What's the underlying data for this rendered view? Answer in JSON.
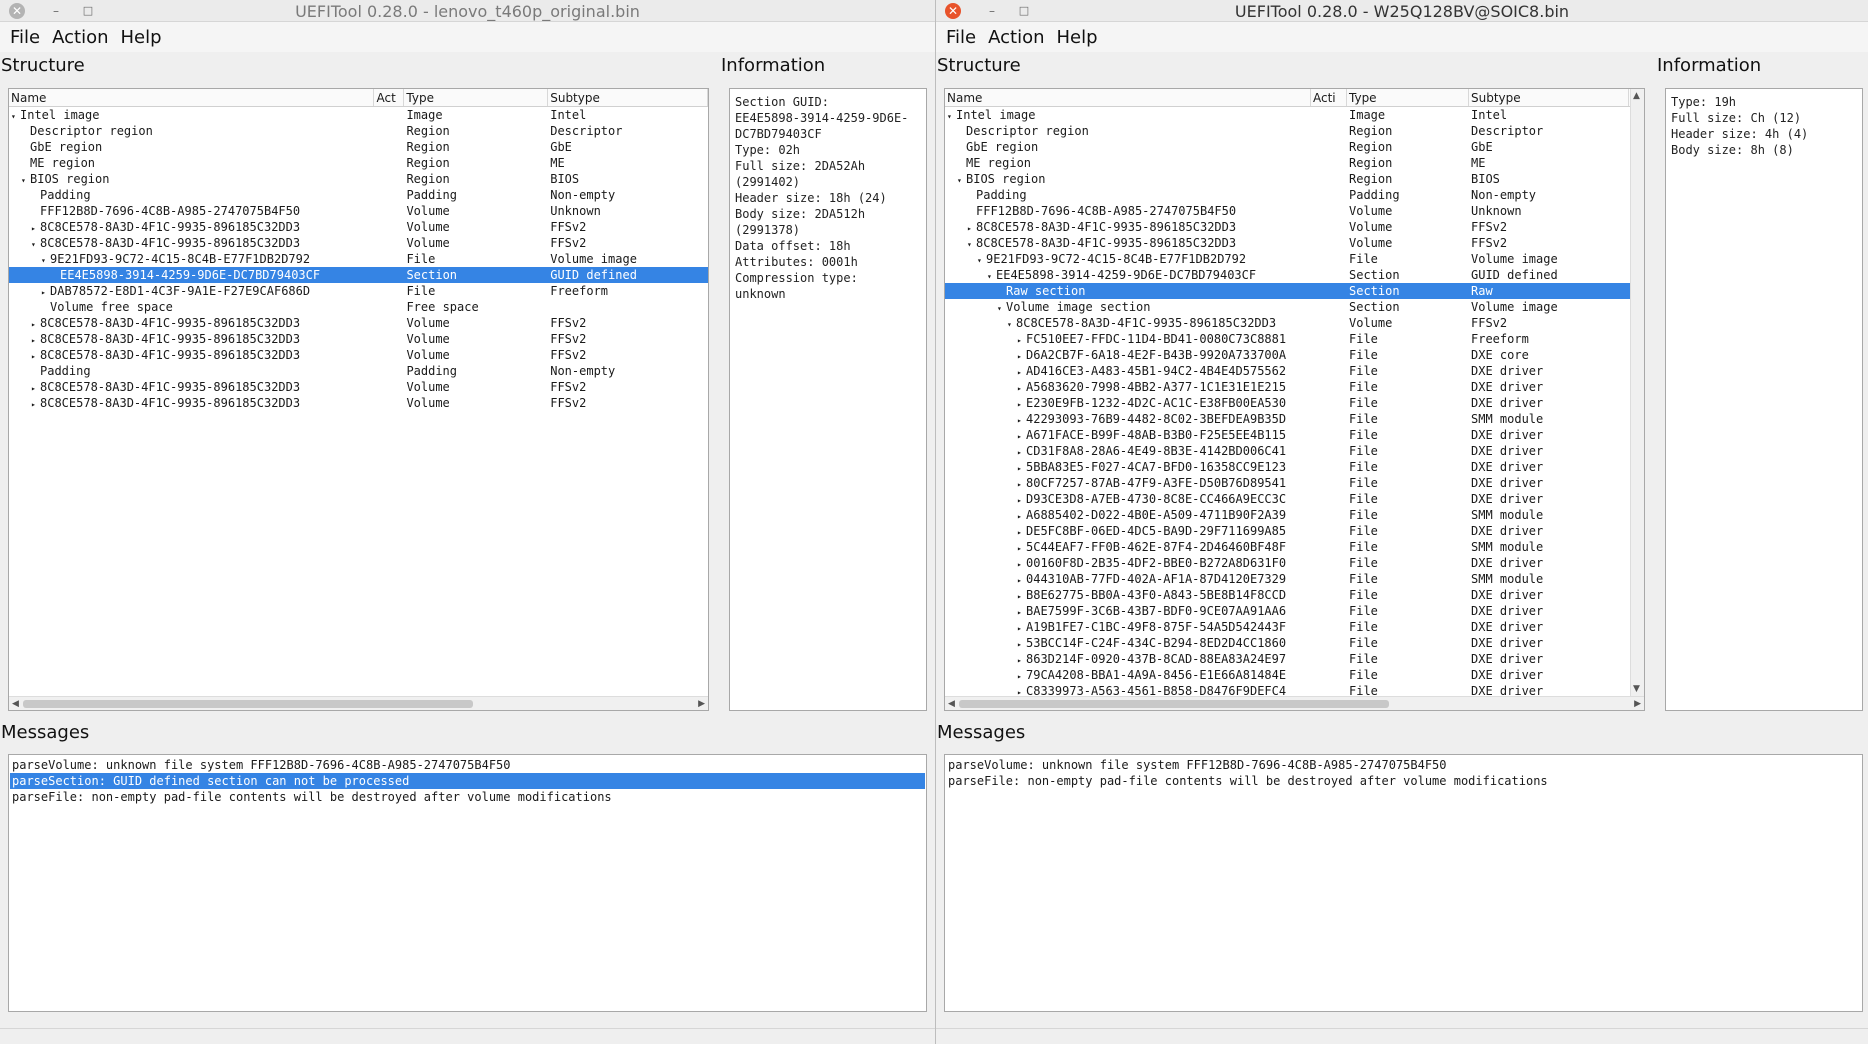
{
  "left": {
    "title": "UEFITool 0.28.0 - lenovo_t460p_original.bin",
    "menu": [
      "File",
      "Action",
      "Help"
    ],
    "structure_label": "Structure",
    "information_label": "Information",
    "messages_label": "Messages",
    "columns": [
      "Name",
      "Act",
      "Type",
      "Subtype"
    ],
    "rows": [
      {
        "indent": 0,
        "arrow": "down",
        "name": "Intel image",
        "type": "Image",
        "subtype": "Intel"
      },
      {
        "indent": 1,
        "arrow": "",
        "name": "Descriptor region",
        "type": "Region",
        "subtype": "Descriptor"
      },
      {
        "indent": 1,
        "arrow": "",
        "name": "GbE region",
        "type": "Region",
        "subtype": "GbE"
      },
      {
        "indent": 1,
        "arrow": "",
        "name": "ME region",
        "type": "Region",
        "subtype": "ME"
      },
      {
        "indent": 1,
        "arrow": "down",
        "name": "BIOS region",
        "type": "Region",
        "subtype": "BIOS"
      },
      {
        "indent": 2,
        "arrow": "",
        "name": "Padding",
        "type": "Padding",
        "subtype": "Non-empty"
      },
      {
        "indent": 2,
        "arrow": "",
        "name": "FFF12B8D-7696-4C8B-A985-2747075B4F50",
        "type": "Volume",
        "subtype": "Unknown"
      },
      {
        "indent": 2,
        "arrow": "right",
        "name": "8C8CE578-8A3D-4F1C-9935-896185C32DD3",
        "type": "Volume",
        "subtype": "FFSv2"
      },
      {
        "indent": 2,
        "arrow": "down",
        "name": "8C8CE578-8A3D-4F1C-9935-896185C32DD3",
        "type": "Volume",
        "subtype": "FFSv2"
      },
      {
        "indent": 3,
        "arrow": "down",
        "name": "9E21FD93-9C72-4C15-8C4B-E77F1DB2D792",
        "type": "File",
        "subtype": "Volume image"
      },
      {
        "indent": 4,
        "arrow": "",
        "name": "EE4E5898-3914-4259-9D6E-DC7BD79403CF",
        "type": "Section",
        "subtype": "GUID defined",
        "selected": true
      },
      {
        "indent": 3,
        "arrow": "right",
        "name": "DAB78572-E8D1-4C3F-9A1E-F27E9CAF686D",
        "type": "File",
        "subtype": "Freeform"
      },
      {
        "indent": 3,
        "arrow": "",
        "name": "Volume free space",
        "type": "Free space",
        "subtype": ""
      },
      {
        "indent": 2,
        "arrow": "right",
        "name": "8C8CE578-8A3D-4F1C-9935-896185C32DD3",
        "type": "Volume",
        "subtype": "FFSv2"
      },
      {
        "indent": 2,
        "arrow": "right",
        "name": "8C8CE578-8A3D-4F1C-9935-896185C32DD3",
        "type": "Volume",
        "subtype": "FFSv2"
      },
      {
        "indent": 2,
        "arrow": "right",
        "name": "8C8CE578-8A3D-4F1C-9935-896185C32DD3",
        "type": "Volume",
        "subtype": "FFSv2"
      },
      {
        "indent": 2,
        "arrow": "",
        "name": "Padding",
        "type": "Padding",
        "subtype": "Non-empty"
      },
      {
        "indent": 2,
        "arrow": "right",
        "name": "8C8CE578-8A3D-4F1C-9935-896185C32DD3",
        "type": "Volume",
        "subtype": "FFSv2"
      },
      {
        "indent": 2,
        "arrow": "right",
        "name": "8C8CE578-8A3D-4F1C-9935-896185C32DD3",
        "type": "Volume",
        "subtype": "FFSv2"
      }
    ],
    "info": "Section GUID:\nEE4E5898-3914-4259-9D6E-\nDC7BD79403CF\nType: 02h\nFull size: 2DA52Ah\n(2991402)\nHeader size: 18h (24)\nBody size: 2DA512h\n(2991378)\nData offset: 18h\nAttributes: 0001h\nCompression type:\nunknown",
    "messages": [
      {
        "text": "parseVolume: unknown file system FFF12B8D-7696-4C8B-A985-2747075B4F50"
      },
      {
        "text": "parseSection: GUID defined section can not be processed",
        "selected": true
      },
      {
        "text": "parseFile: non-empty pad-file contents will be destroyed after volume modifications"
      }
    ]
  },
  "right": {
    "title": "UEFITool 0.28.0 - W25Q128BV@SOIC8.bin",
    "menu": [
      "File",
      "Action",
      "Help"
    ],
    "structure_label": "Structure",
    "information_label": "Information",
    "messages_label": "Messages",
    "columns": [
      "Name",
      "Acti",
      "Type",
      "Subtype"
    ],
    "rows": [
      {
        "indent": 0,
        "arrow": "down",
        "name": "Intel image",
        "type": "Image",
        "subtype": "Intel"
      },
      {
        "indent": 1,
        "arrow": "",
        "name": "Descriptor region",
        "type": "Region",
        "subtype": "Descriptor"
      },
      {
        "indent": 1,
        "arrow": "",
        "name": "GbE region",
        "type": "Region",
        "subtype": "GbE"
      },
      {
        "indent": 1,
        "arrow": "",
        "name": "ME region",
        "type": "Region",
        "subtype": "ME"
      },
      {
        "indent": 1,
        "arrow": "down",
        "name": "BIOS region",
        "type": "Region",
        "subtype": "BIOS"
      },
      {
        "indent": 2,
        "arrow": "",
        "name": "Padding",
        "type": "Padding",
        "subtype": "Non-empty"
      },
      {
        "indent": 2,
        "arrow": "",
        "name": "FFF12B8D-7696-4C8B-A985-2747075B4F50",
        "type": "Volume",
        "subtype": "Unknown"
      },
      {
        "indent": 2,
        "arrow": "right",
        "name": "8C8CE578-8A3D-4F1C-9935-896185C32DD3",
        "type": "Volume",
        "subtype": "FFSv2"
      },
      {
        "indent": 2,
        "arrow": "down",
        "name": "8C8CE578-8A3D-4F1C-9935-896185C32DD3",
        "type": "Volume",
        "subtype": "FFSv2"
      },
      {
        "indent": 3,
        "arrow": "down",
        "name": "9E21FD93-9C72-4C15-8C4B-E77F1DB2D792",
        "type": "File",
        "subtype": "Volume image"
      },
      {
        "indent": 4,
        "arrow": "down",
        "name": "EE4E5898-3914-4259-9D6E-DC7BD79403CF",
        "type": "Section",
        "subtype": "GUID defined"
      },
      {
        "indent": 5,
        "arrow": "",
        "name": "Raw section",
        "type": "Section",
        "subtype": "Raw",
        "selected": true
      },
      {
        "indent": 5,
        "arrow": "down",
        "name": "Volume image section",
        "type": "Section",
        "subtype": "Volume image"
      },
      {
        "indent": 6,
        "arrow": "down",
        "name": "8C8CE578-8A3D-4F1C-9935-896185C32DD3",
        "type": "Volume",
        "subtype": "FFSv2"
      },
      {
        "indent": 7,
        "arrow": "right",
        "name": "FC510EE7-FFDC-11D4-BD41-0080C73C8881",
        "type": "File",
        "subtype": "Freeform"
      },
      {
        "indent": 7,
        "arrow": "right",
        "name": "D6A2CB7F-6A18-4E2F-B43B-9920A733700A",
        "type": "File",
        "subtype": "DXE core"
      },
      {
        "indent": 7,
        "arrow": "right",
        "name": "AD416CE3-A483-45B1-94C2-4B4E4D575562",
        "type": "File",
        "subtype": "DXE driver"
      },
      {
        "indent": 7,
        "arrow": "right",
        "name": "A5683620-7998-4BB2-A377-1C1E31E1E215",
        "type": "File",
        "subtype": "DXE driver"
      },
      {
        "indent": 7,
        "arrow": "right",
        "name": "E230E9FB-1232-4D2C-AC1C-E38FB00EA530",
        "type": "File",
        "subtype": "DXE driver"
      },
      {
        "indent": 7,
        "arrow": "right",
        "name": "42293093-76B9-4482-8C02-3BEFDEA9B35D",
        "type": "File",
        "subtype": "SMM module"
      },
      {
        "indent": 7,
        "arrow": "right",
        "name": "A671FACE-B99F-48AB-B3B0-F25E5EE4B115",
        "type": "File",
        "subtype": "DXE driver"
      },
      {
        "indent": 7,
        "arrow": "right",
        "name": "CD31F8A8-28A6-4E49-8B3E-4142BD006C41",
        "type": "File",
        "subtype": "DXE driver"
      },
      {
        "indent": 7,
        "arrow": "right",
        "name": "5BBA83E5-F027-4CA7-BFD0-16358CC9E123",
        "type": "File",
        "subtype": "DXE driver"
      },
      {
        "indent": 7,
        "arrow": "right",
        "name": "80CF7257-87AB-47F9-A3FE-D50B76D89541",
        "type": "File",
        "subtype": "DXE driver"
      },
      {
        "indent": 7,
        "arrow": "right",
        "name": "D93CE3D8-A7EB-4730-8C8E-CC466A9ECC3C",
        "type": "File",
        "subtype": "DXE driver"
      },
      {
        "indent": 7,
        "arrow": "right",
        "name": "A6885402-D022-4B0E-A509-4711B90F2A39",
        "type": "File",
        "subtype": "SMM module"
      },
      {
        "indent": 7,
        "arrow": "right",
        "name": "DE5FC8BF-06ED-4DC5-BA9D-29F711699A85",
        "type": "File",
        "subtype": "DXE driver"
      },
      {
        "indent": 7,
        "arrow": "right",
        "name": "5C44EAF7-FF0B-462E-87F4-2D46460BF48F",
        "type": "File",
        "subtype": "SMM module"
      },
      {
        "indent": 7,
        "arrow": "right",
        "name": "00160F8D-2B35-4DF2-BBE0-B272A8D631F0",
        "type": "File",
        "subtype": "DXE driver"
      },
      {
        "indent": 7,
        "arrow": "right",
        "name": "044310AB-77FD-402A-AF1A-87D4120E7329",
        "type": "File",
        "subtype": "SMM module"
      },
      {
        "indent": 7,
        "arrow": "right",
        "name": "B8E62775-BB0A-43F0-A843-5BE8B14F8CCD",
        "type": "File",
        "subtype": "DXE driver"
      },
      {
        "indent": 7,
        "arrow": "right",
        "name": "BAE7599F-3C6B-43B7-BDF0-9CE07AA91AA6",
        "type": "File",
        "subtype": "DXE driver"
      },
      {
        "indent": 7,
        "arrow": "right",
        "name": "A19B1FE7-C1BC-49F8-875F-54A5D542443F",
        "type": "File",
        "subtype": "DXE driver"
      },
      {
        "indent": 7,
        "arrow": "right",
        "name": "53BCC14F-C24F-434C-B294-8ED2D4CC1860",
        "type": "File",
        "subtype": "DXE driver"
      },
      {
        "indent": 7,
        "arrow": "right",
        "name": "863D214F-0920-437B-8CAD-88EA83A24E97",
        "type": "File",
        "subtype": "DXE driver"
      },
      {
        "indent": 7,
        "arrow": "right",
        "name": "79CA4208-BBA1-4A9A-8456-E1E66A81484E",
        "type": "File",
        "subtype": "DXE driver"
      },
      {
        "indent": 7,
        "arrow": "right",
        "name": "C8339973-A563-4561-B858-D8476F9DEFC4",
        "type": "File",
        "subtype": "DXE driver"
      }
    ],
    "info": "Type: 19h\nFull size: Ch (12)\nHeader size: 4h (4)\nBody size: 8h (8)",
    "messages": [
      {
        "text": "parseVolume: unknown file system FFF12B8D-7696-4C8B-A985-2747075B4F50"
      },
      {
        "text": "parseFile: non-empty pad-file contents will be destroyed after volume modifications"
      }
    ]
  },
  "icons": {
    "close": "close-icon",
    "minimize": "minimize-icon",
    "maximize": "maximize-icon",
    "arrow_right": "▸",
    "arrow_down": "▾",
    "scroll_left": "◀",
    "scroll_right": "▶",
    "scroll_up": "▲",
    "scroll_down": "▼"
  },
  "colors": {
    "selection": "#3584e4",
    "close_active": "#e8532b",
    "close_inactive": "#b3b3b3"
  }
}
